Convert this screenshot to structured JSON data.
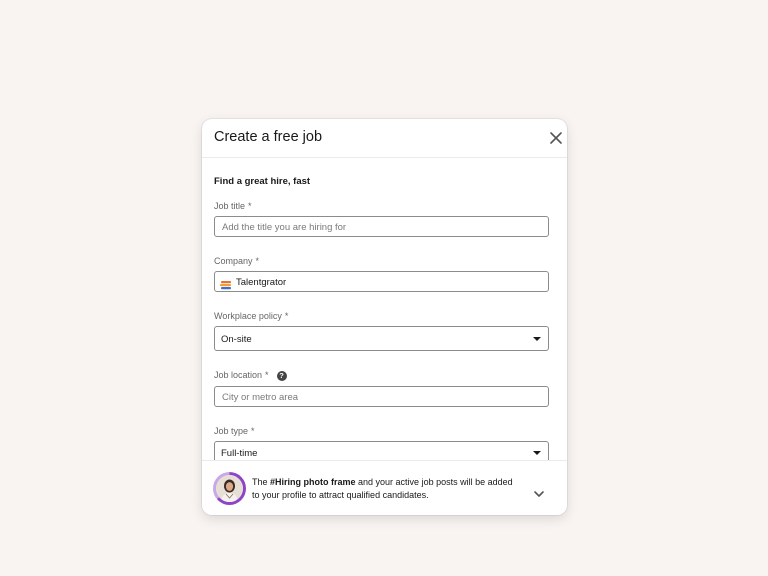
{
  "modal": {
    "title": "Create a free job",
    "subheading": "Find a great hire, fast",
    "required_marker": "*",
    "fields": {
      "job_title": {
        "label": "Job title",
        "placeholder": "Add the title you are hiring for",
        "value": ""
      },
      "company": {
        "label": "Company",
        "value": "Talentgrator",
        "logo_icon": "talentgrator-logo-icon"
      },
      "workplace_policy": {
        "label": "Workplace policy",
        "value": "On-site"
      },
      "job_location": {
        "label": "Job location",
        "placeholder": "City or metro area",
        "value": "",
        "help_glyph": "?"
      },
      "job_type": {
        "label": "Job type",
        "value": "Full-time"
      }
    },
    "footer": {
      "text_before": "The ",
      "text_bold": "#Hiring photo frame",
      "text_after": " and your active job posts will be added to your profile to attract qualified candidates."
    }
  },
  "colors": {
    "page_background": "#f9f4f2",
    "accent_purple": "#8e44c8",
    "field_border": "#8c8c8c"
  }
}
